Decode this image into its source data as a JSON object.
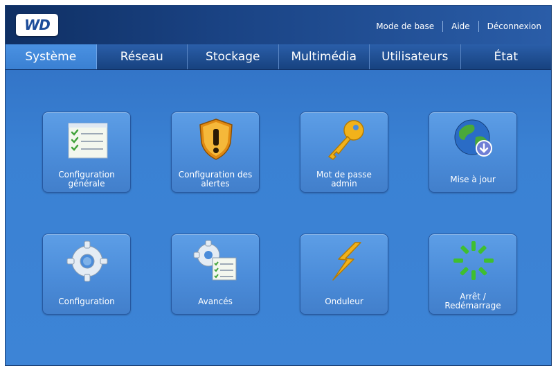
{
  "header": {
    "logo_text": "WD",
    "links": {
      "basic_mode": "Mode de base",
      "help": "Aide",
      "logout": "Déconnexion"
    }
  },
  "tabs": [
    {
      "label": "Système",
      "active": true
    },
    {
      "label": "Réseau",
      "active": false
    },
    {
      "label": "Stockage",
      "active": false
    },
    {
      "label": "Multimédia",
      "active": false
    },
    {
      "label": "Utilisateurs",
      "active": false
    },
    {
      "label": "État",
      "active": false
    }
  ],
  "tiles": [
    {
      "label": "Configuration\ngénérale",
      "icon": "checklist-icon"
    },
    {
      "label": "Configuration des\nalertes",
      "icon": "alert-shield-icon"
    },
    {
      "label": "Mot de passe\nadmin",
      "icon": "key-icon"
    },
    {
      "label": "Mise à jour",
      "icon": "globe-download-icon"
    },
    {
      "label": "Configuration",
      "icon": "gear-icon"
    },
    {
      "label": "Avancés",
      "icon": "gears-checklist-icon"
    },
    {
      "label": "Onduleur",
      "icon": "lightning-icon"
    },
    {
      "label": "Arrêt /\nRedémarrage",
      "icon": "restart-spinner-icon"
    }
  ],
  "colors": {
    "background": "#3d84d6",
    "header": "#1a4384",
    "tile": "#4b8cd9",
    "active_tab": "#4a91e2"
  }
}
